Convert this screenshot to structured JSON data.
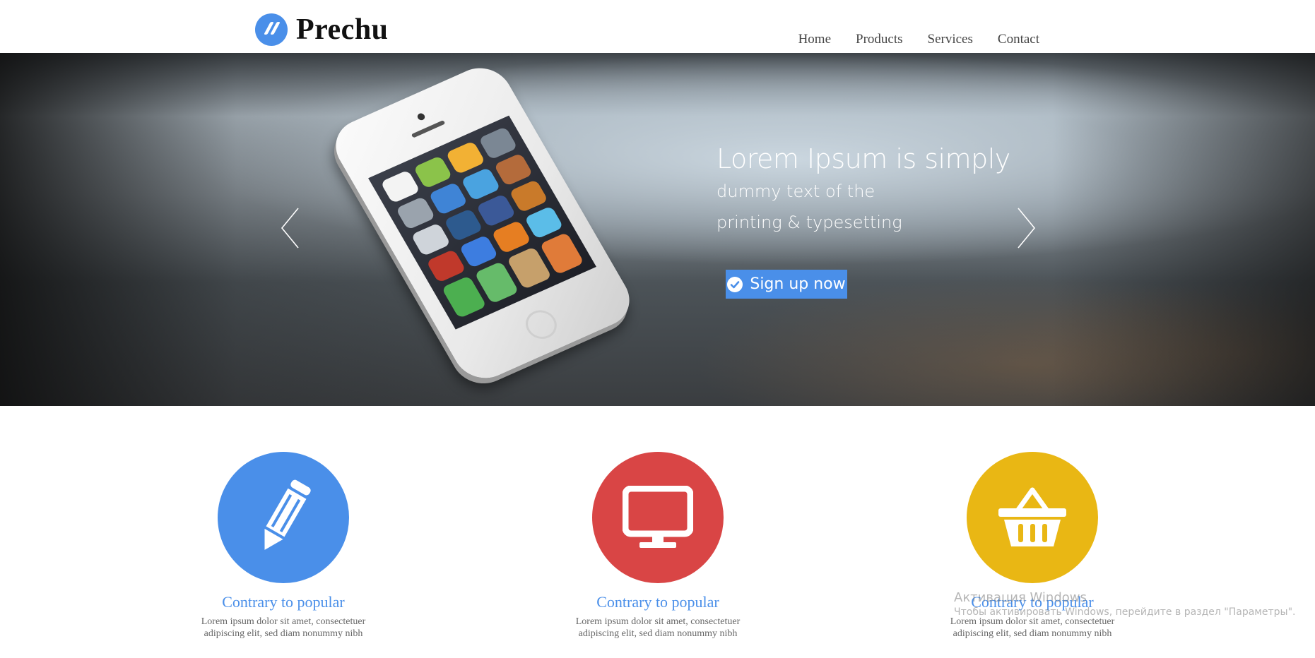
{
  "brand": {
    "name": "Prechu",
    "logo_icon": "double-slash-logo-icon"
  },
  "nav": {
    "items": [
      {
        "label": "Home"
      },
      {
        "label": "Products"
      },
      {
        "label": "Services"
      },
      {
        "label": "Contact"
      }
    ]
  },
  "hero": {
    "title": "Lorem Ipsum is simply",
    "subtitle_line1": "dummy text of the",
    "subtitle_line2": "printing & typesetting",
    "cta_label": "Sign up now",
    "cta_icon": "check-circle-icon",
    "prev_icon": "chevron-left-icon",
    "next_icon": "chevron-right-icon",
    "image": "smartphone-image"
  },
  "features": [
    {
      "icon": "pencil-icon",
      "color": "#4a8fe9",
      "title": "Contrary to popular",
      "text_line1": "Lorem ipsum dolor sit amet, consectetuer",
      "text_line2": "adipiscing elit, sed diam nonummy nibh"
    },
    {
      "icon": "monitor-icon",
      "color": "#d94545",
      "title": "Contrary to popular",
      "text_line1": "Lorem ipsum dolor sit amet, consectetuer",
      "text_line2": "adipiscing elit, sed diam nonummy nibh"
    },
    {
      "icon": "basket-icon",
      "color": "#e9b714",
      "title": "Contrary to popular",
      "text_line1": "Lorem ipsum dolor sit amet, consectetuer",
      "text_line2": "adipiscing elit, sed diam nonummy nibh"
    }
  ],
  "watermark": {
    "title": "Активация Windows",
    "subtitle": "Чтобы активировать Windows, перейдите в раздел \"Параметры\"."
  },
  "colors": {
    "accent": "#4a8fe9",
    "red": "#d94545",
    "yellow": "#e9b714"
  }
}
